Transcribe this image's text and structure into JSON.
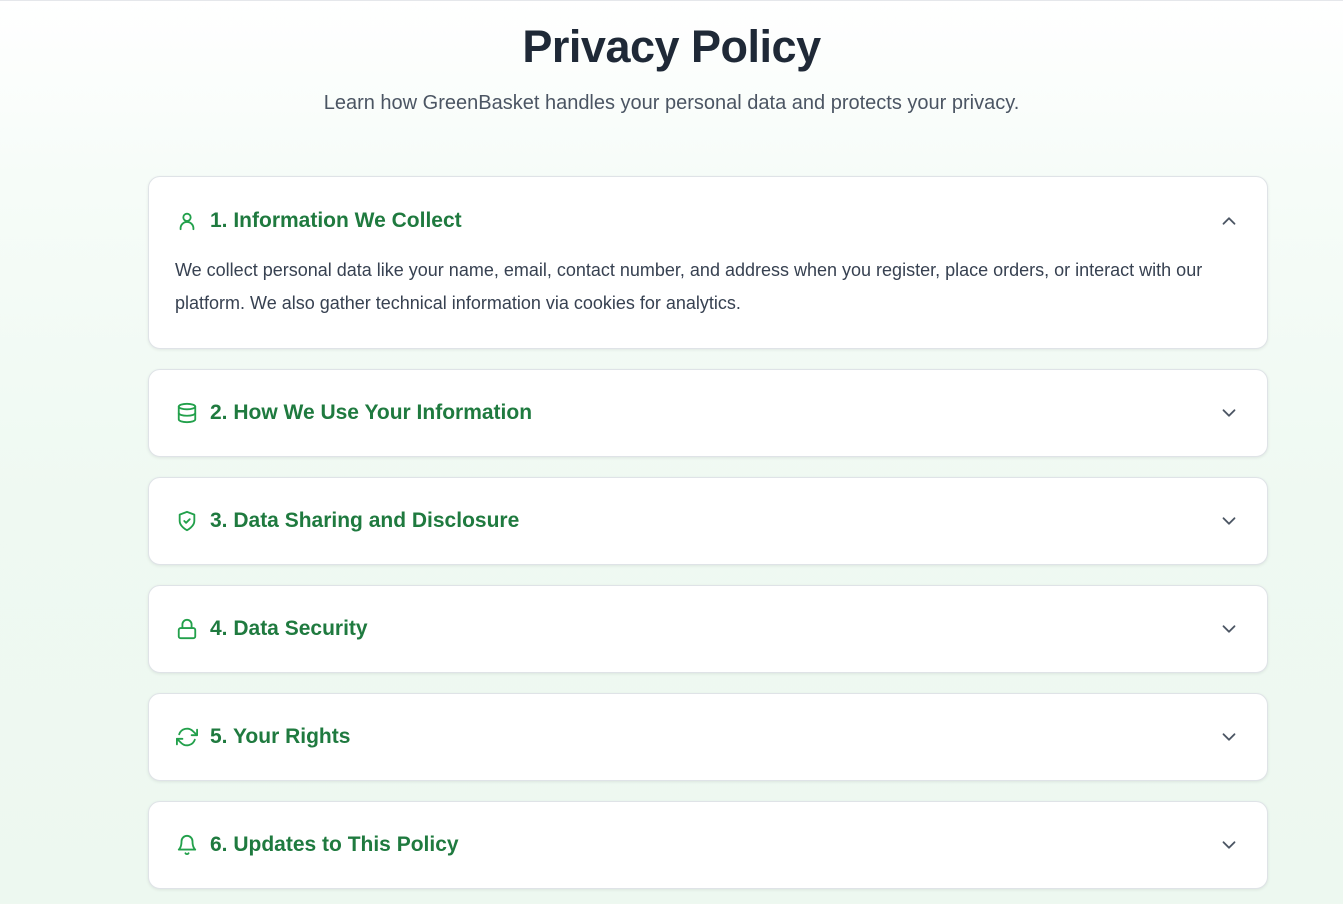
{
  "header": {
    "title": "Privacy Policy",
    "subtitle": "Learn how GreenBasket handles your personal data and protects your privacy."
  },
  "sections": [
    {
      "title": "1. Information We Collect",
      "icon": "user-icon",
      "expanded": true,
      "body": "We collect personal data like your name, email, contact number, and address when you register, place orders, or interact with our platform. We also gather technical information via cookies for analytics."
    },
    {
      "title": "2. How We Use Your Information",
      "icon": "database-icon",
      "expanded": false
    },
    {
      "title": "3. Data Sharing and Disclosure",
      "icon": "shield-check-icon",
      "expanded": false
    },
    {
      "title": "4. Data Security",
      "icon": "lock-icon",
      "expanded": false
    },
    {
      "title": "5. Your Rights",
      "icon": "refresh-icon",
      "expanded": false
    },
    {
      "title": "6. Updates to This Policy",
      "icon": "bell-icon",
      "expanded": false
    }
  ],
  "colors": {
    "accent": "#1f7a3f",
    "icon": "#22a04b",
    "chevron": "#4b5563"
  }
}
